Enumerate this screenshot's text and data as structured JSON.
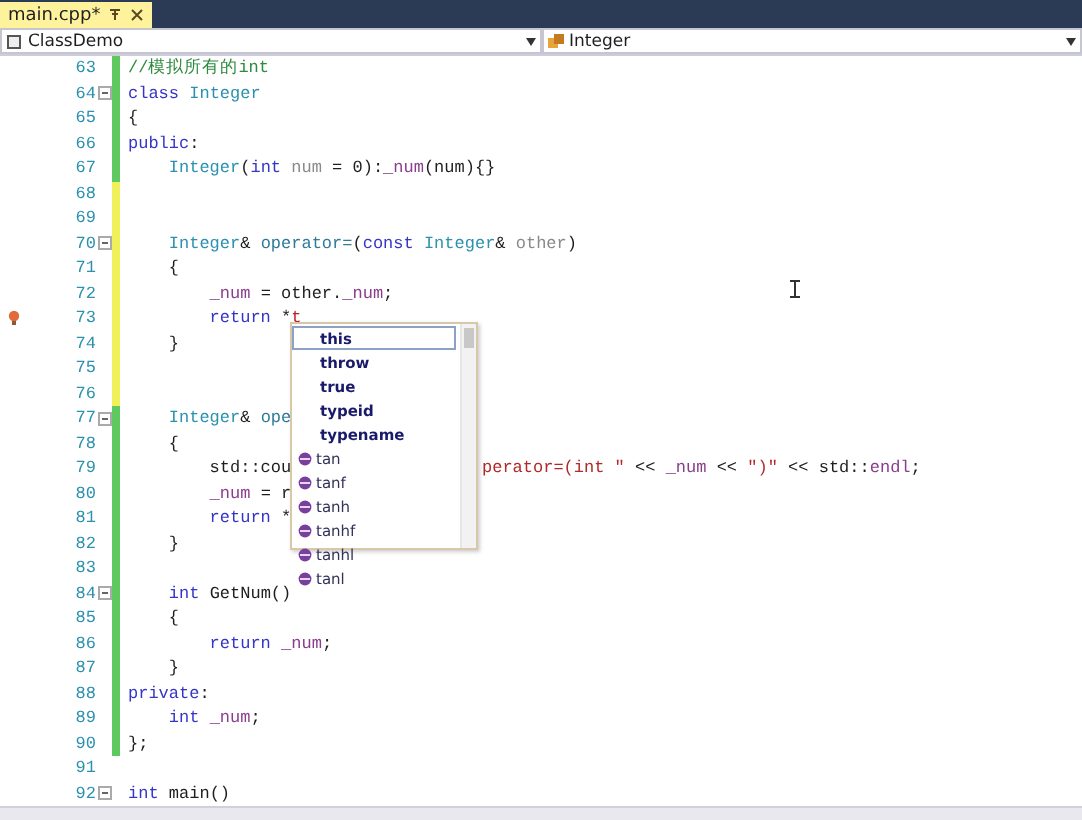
{
  "tab": {
    "title": "main.cpp*",
    "selected": true
  },
  "nav": {
    "project": "ClassDemo",
    "scope": "Integer"
  },
  "lines": [
    {
      "number": "63",
      "saved": true,
      "collapsible": false,
      "tokens": [
        {
          "kind": "comment",
          "text": "//模拟所有的int"
        }
      ]
    },
    {
      "number": "64",
      "saved": true,
      "collapsible": true,
      "tokens": [
        {
          "kind": "kw",
          "text": "class"
        },
        {
          "kind": "type",
          "text": " Integer"
        }
      ]
    },
    {
      "number": "65",
      "saved": true,
      "collapsible": false,
      "tokens": [
        {
          "kind": "plain",
          "text": "{"
        }
      ]
    },
    {
      "number": "66",
      "saved": true,
      "collapsible": false,
      "tokens": [
        {
          "kind": "kw",
          "text": "public"
        },
        {
          "kind": "plain",
          "text": ":"
        }
      ]
    },
    {
      "number": "67",
      "saved": true,
      "collapsible": false,
      "tokens": [
        {
          "kind": "type",
          "text": "    Integer"
        },
        {
          "kind": "plain",
          "text": "("
        },
        {
          "kind": "kw",
          "text": "int"
        },
        {
          "kind": "param",
          "text": " num"
        },
        {
          "kind": "plain",
          "text": " = 0):"
        },
        {
          "kind": "member",
          "text": "_num"
        },
        {
          "kind": "plain",
          "text": "(num){}"
        }
      ]
    },
    {
      "number": "68",
      "saved": false,
      "collapsible": false
    },
    {
      "number": "69",
      "saved": false,
      "collapsible": false
    },
    {
      "number": "70",
      "saved": false,
      "collapsible": true,
      "tokens": [
        {
          "kind": "type",
          "text": "    Integer"
        },
        {
          "kind": "plain",
          "text": "&"
        },
        {
          "kind": "func",
          "text": " operator="
        },
        {
          "kind": "plain",
          "text": "("
        },
        {
          "kind": "kw",
          "text": "const"
        },
        {
          "kind": "type",
          "text": " Integer"
        },
        {
          "kind": "plain",
          "text": "&"
        },
        {
          "kind": "param",
          "text": " other"
        },
        {
          "kind": "plain",
          "text": ")"
        }
      ]
    },
    {
      "number": "71",
      "saved": false,
      "collapsible": false,
      "tokens": [
        {
          "kind": "plain",
          "text": "    {"
        }
      ]
    },
    {
      "number": "72",
      "saved": false,
      "collapsible": false,
      "tokens": [
        {
          "kind": "member",
          "text": "        _num"
        },
        {
          "kind": "plain",
          "text": " = other."
        },
        {
          "kind": "member",
          "text": "_num"
        },
        {
          "kind": "plain",
          "text": ";"
        }
      ]
    },
    {
      "number": "73",
      "saved": false,
      "collapsible": false,
      "marker": true,
      "tokens": [
        {
          "kind": "kw",
          "text": "        return"
        },
        {
          "kind": "plain",
          "text": " *"
        },
        {
          "kind": "error",
          "text": "t"
        }
      ]
    },
    {
      "number": "74",
      "saved": false,
      "collapsible": false,
      "tokens": [
        {
          "kind": "plain",
          "text": "    }"
        }
      ]
    },
    {
      "number": "75",
      "saved": false,
      "collapsible": false
    },
    {
      "number": "76",
      "saved": false,
      "collapsible": false
    },
    {
      "number": "77",
      "saved": true,
      "collapsible": true,
      "tokens": [
        {
          "kind": "type",
          "text": "    Integer"
        },
        {
          "kind": "plain",
          "text": "&"
        },
        {
          "kind": "func",
          "text": " ope"
        }
      ]
    },
    {
      "number": "78",
      "saved": true,
      "collapsible": false,
      "tokens": [
        {
          "kind": "plain",
          "text": "    {"
        }
      ]
    },
    {
      "number": "79",
      "saved": true,
      "collapsible": false,
      "tokens": [
        {
          "kind": "plain",
          "text": "        std::cou"
        }
      ],
      "tail": [
        {
          "kind": "string",
          "text": "perator=(int \""
        },
        {
          "kind": "plain",
          "text": " << "
        },
        {
          "kind": "member",
          "text": "_num"
        },
        {
          "kind": "plain",
          "text": " << "
        },
        {
          "kind": "string",
          "text": "\")\""
        },
        {
          "kind": "plain",
          "text": " << std::"
        },
        {
          "kind": "member",
          "text": "endl"
        },
        {
          "kind": "plain",
          "text": ";"
        }
      ]
    },
    {
      "number": "80",
      "saved": true,
      "collapsible": false,
      "tokens": [
        {
          "kind": "member",
          "text": "        _num"
        },
        {
          "kind": "plain",
          "text": " = r"
        }
      ]
    },
    {
      "number": "81",
      "saved": true,
      "collapsible": false,
      "tokens": [
        {
          "kind": "kw",
          "text": "        return"
        },
        {
          "kind": "plain",
          "text": " *"
        }
      ]
    },
    {
      "number": "82",
      "saved": true,
      "collapsible": false,
      "tokens": [
        {
          "kind": "plain",
          "text": "    }"
        }
      ]
    },
    {
      "number": "83",
      "saved": true,
      "collapsible": false
    },
    {
      "number": "84",
      "saved": true,
      "collapsible": true,
      "tokens": [
        {
          "kind": "kw",
          "text": "    int"
        },
        {
          "kind": "plain",
          "text": " GetNum()"
        }
      ]
    },
    {
      "number": "85",
      "saved": true,
      "collapsible": false,
      "tokens": [
        {
          "kind": "plain",
          "text": "    {"
        }
      ]
    },
    {
      "number": "86",
      "saved": true,
      "collapsible": false,
      "tokens": [
        {
          "kind": "kw",
          "text": "        return"
        },
        {
          "kind": "member",
          "text": " _num"
        },
        {
          "kind": "plain",
          "text": ";"
        }
      ]
    },
    {
      "number": "87",
      "saved": true,
      "collapsible": false,
      "tokens": [
        {
          "kind": "plain",
          "text": "    }"
        }
      ]
    },
    {
      "number": "88",
      "saved": true,
      "collapsible": false,
      "tokens": [
        {
          "kind": "kw",
          "text": "private"
        },
        {
          "kind": "plain",
          "text": ":"
        }
      ]
    },
    {
      "number": "89",
      "saved": true,
      "collapsible": false,
      "tokens": [
        {
          "kind": "kw",
          "text": "    int"
        },
        {
          "kind": "member",
          "text": " _num"
        },
        {
          "kind": "plain",
          "text": ";"
        }
      ]
    },
    {
      "number": "90",
      "saved": true,
      "collapsible": false,
      "tokens": [
        {
          "kind": "plain",
          "text": "};"
        }
      ]
    },
    {
      "number": "91",
      "collapsible": false
    },
    {
      "number": "92",
      "collapsible": true,
      "tokens": [
        {
          "kind": "kw",
          "text": "int"
        },
        {
          "kind": "plain",
          "text": " main()"
        }
      ]
    }
  ],
  "completion": [
    {
      "text": "this",
      "kind": "keyword",
      "selected": true
    },
    {
      "text": "throw",
      "kind": "keyword",
      "selected": false
    },
    {
      "text": "true",
      "kind": "keyword",
      "selected": false
    },
    {
      "text": "typeid",
      "kind": "keyword",
      "selected": false
    },
    {
      "text": "typename",
      "kind": "keyword",
      "selected": false
    },
    {
      "text": "tan",
      "kind": "function",
      "selected": false
    },
    {
      "text": "tanf",
      "kind": "function",
      "selected": false
    },
    {
      "text": "tanh",
      "kind": "function",
      "selected": false
    },
    {
      "text": "tanhf",
      "kind": "function",
      "selected": false
    },
    {
      "text": "tanhl",
      "kind": "function",
      "selected": false
    },
    {
      "text": "tanl",
      "kind": "function",
      "selected": false
    }
  ]
}
